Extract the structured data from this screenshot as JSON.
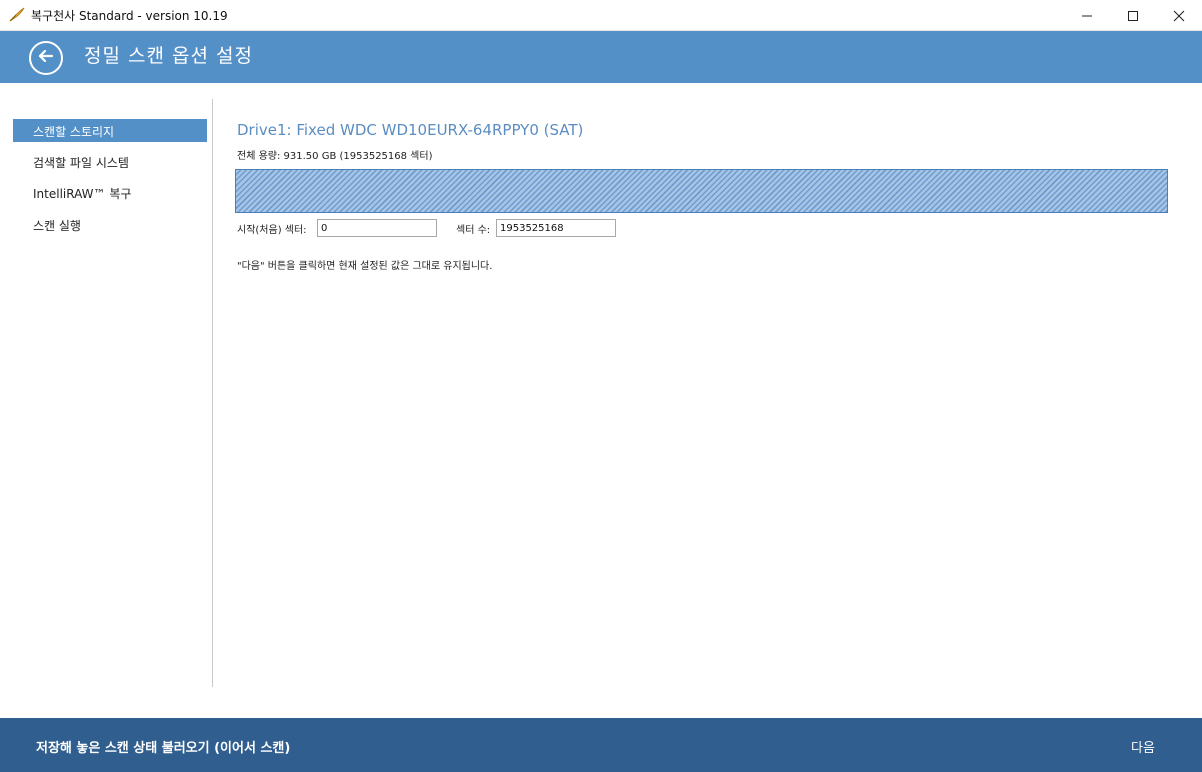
{
  "window": {
    "title": "복구천사 Standard - version 10.19"
  },
  "header": {
    "title": "정밀 스캔 옵션 설정"
  },
  "sidebar": {
    "items": [
      {
        "label": "스캔할 스토리지",
        "active": true
      },
      {
        "label": "검색할 파일 시스템",
        "active": false
      },
      {
        "label": "IntelliRAW™ 복구",
        "active": false
      },
      {
        "label": "스캔 실행",
        "active": false
      }
    ]
  },
  "main": {
    "drive_title": "Drive1: Fixed WDC WD10EURX-64RPPY0 (SAT)",
    "capacity": "전체 용량: 931.50 GB (1953525168 섹터)",
    "start_label": "시작(처음) 섹터:",
    "start_value": "0",
    "count_label": "섹터 수:",
    "count_value": "1953525168",
    "hint": "\"다음\" 버튼을 클릭하면 현재 설정된 값은 그대로 유지됩니다."
  },
  "footer": {
    "load_label": "저장해 놓은 스캔 상태 불러오기 (이어서 스캔)",
    "next_label": "다음"
  },
  "colors": {
    "header": "#5490c8",
    "footer": "#305e8e",
    "accent_text": "#5b8dc2",
    "active_item": "#5490c8"
  },
  "icons": [
    "app-feather-icon",
    "minimize-icon",
    "maximize-icon",
    "close-icon",
    "back-arrow-icon"
  ]
}
